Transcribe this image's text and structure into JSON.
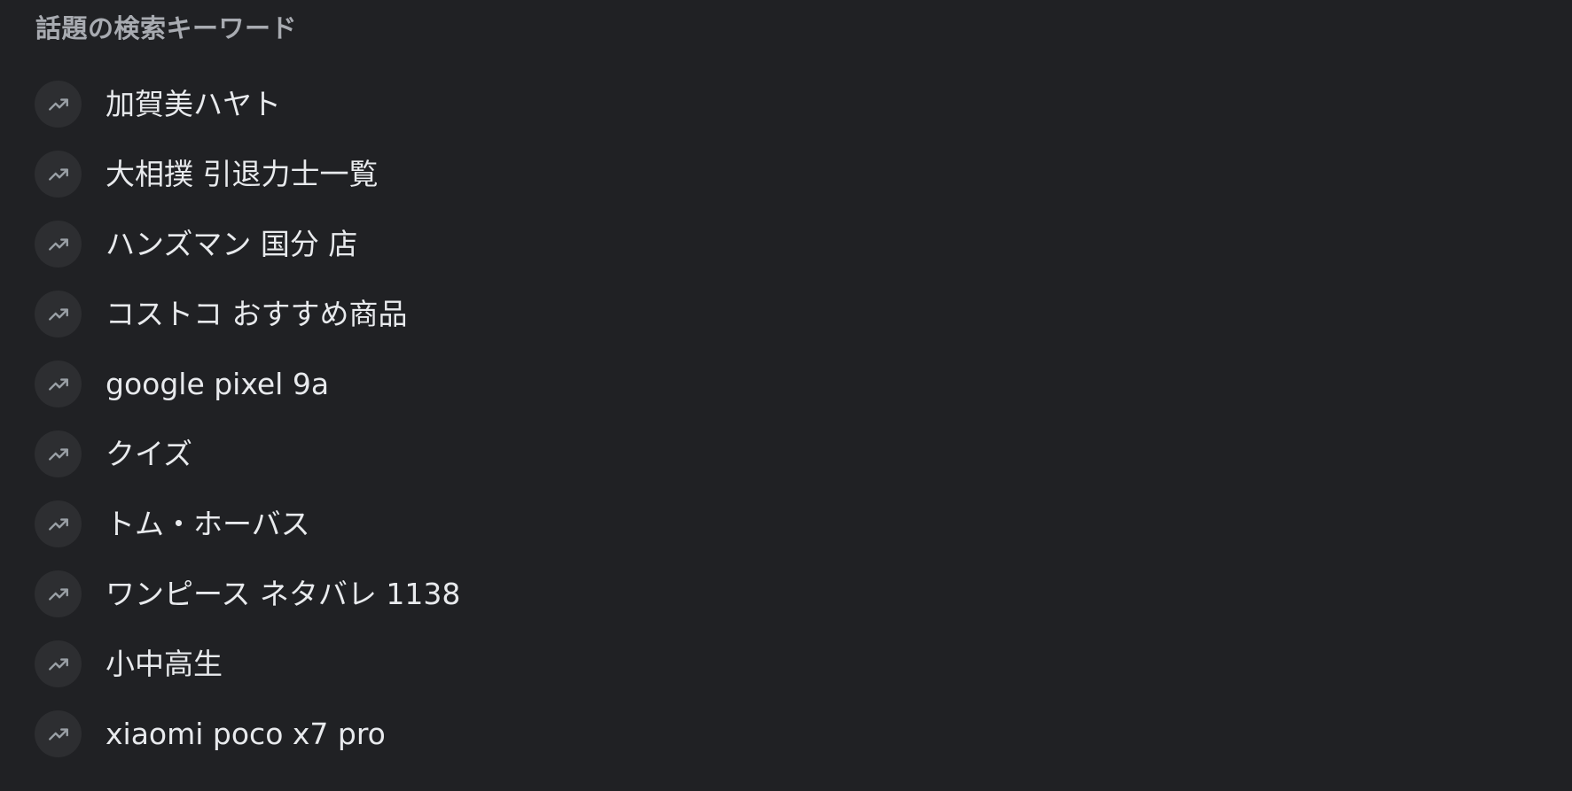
{
  "trending": {
    "title": "話題の検索キーワード",
    "icon": "trending-up-icon",
    "colors": {
      "background": "#202124",
      "title": "#a8abb1",
      "text": "#e8eaed",
      "icon_bg": "#2d2e31",
      "icon": "#9aa0a6"
    },
    "items": [
      {
        "label": "加賀美ハヤト"
      },
      {
        "label": "大相撲 引退力士一覧"
      },
      {
        "label": "ハンズマン 国分 店"
      },
      {
        "label": "コストコ おすすめ商品"
      },
      {
        "label": "google pixel 9a"
      },
      {
        "label": "クイズ"
      },
      {
        "label": "トム・ホーバス"
      },
      {
        "label": "ワンピース ネタバレ 1138"
      },
      {
        "label": "小中高生"
      },
      {
        "label": "xiaomi poco x7 pro"
      }
    ]
  }
}
